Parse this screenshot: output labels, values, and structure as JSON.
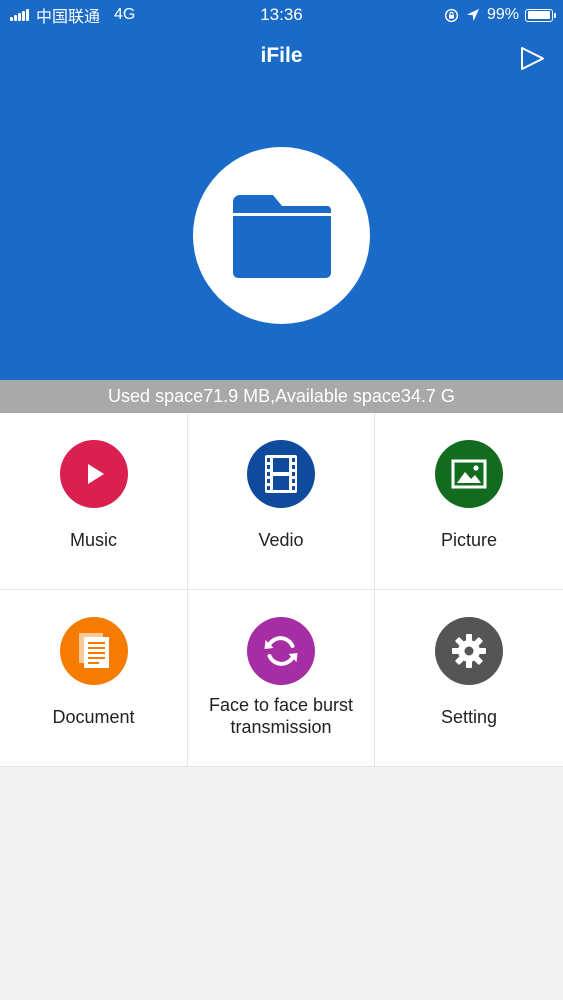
{
  "status_bar": {
    "carrier": "中国联通",
    "network": "4G",
    "time": "13:36",
    "battery": "99%",
    "battery_level": 0.99
  },
  "header": {
    "title": "iFile",
    "icon": "folder-icon",
    "action_icon": "play-icon"
  },
  "storage": {
    "text": "Used space71.9 MB,Available space34.7 G"
  },
  "grid": {
    "items": [
      {
        "label": "Music",
        "icon": "play-circle-icon",
        "color": "#d9204f"
      },
      {
        "label": "Vedio",
        "icon": "film-icon",
        "color": "#0f4a9c"
      },
      {
        "label": "Picture",
        "icon": "image-icon",
        "color": "#136b1f"
      },
      {
        "label": "Document",
        "icon": "document-icon",
        "color": "#f57c00"
      },
      {
        "label": "Face to face burst transmission",
        "icon": "sync-icon",
        "color": "#a62ea4"
      },
      {
        "label": "Setting",
        "icon": "gear-icon",
        "color": "#555555"
      }
    ]
  },
  "colors": {
    "header": "#1a6bc8",
    "storage_bar": "#a9a9a9",
    "background": "#f2f2f2"
  }
}
